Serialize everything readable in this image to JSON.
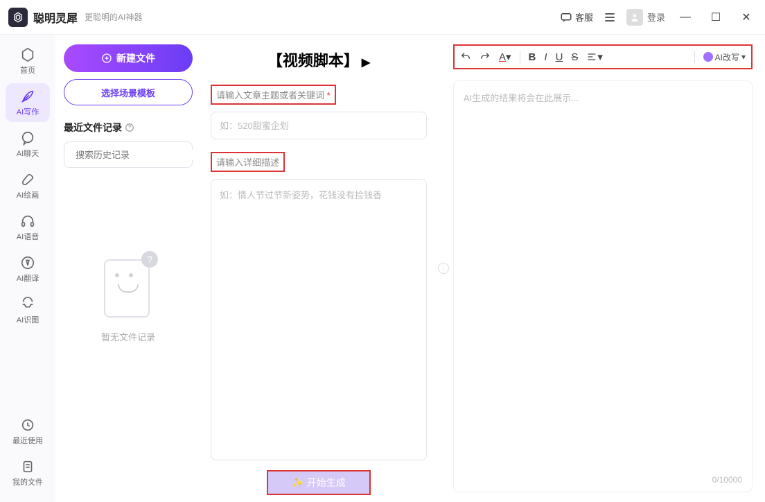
{
  "title": {
    "brand": "聪明灵犀",
    "sub": "更聪明的AI神器"
  },
  "header": {
    "kefu": "客服",
    "login": "登录"
  },
  "sidebar": {
    "items": [
      {
        "label": "首页"
      },
      {
        "label": "AI写作"
      },
      {
        "label": "AI聊天"
      },
      {
        "label": "AI绘画"
      },
      {
        "label": "AI语音"
      },
      {
        "label": "AI翻译"
      },
      {
        "label": "AI识图"
      },
      {
        "label": "最近使用"
      },
      {
        "label": "我的文件"
      }
    ]
  },
  "col2": {
    "new_file": "新建文件",
    "select_tpl": "选择场景模板",
    "recent_head": "最近文件记录",
    "search_ph": "搜索历史记录",
    "empty": "暂无文件记录"
  },
  "col3": {
    "heading": "【视频脚本】",
    "label1": "请输入文章主题或者关键词",
    "ph1": "如：520甜蜜企划",
    "label2": "请输入详细描述",
    "ph2": "如：情人节过节新姿势，花钱没有捡钱香",
    "generate": "开始生成"
  },
  "col4": {
    "ai_rewrite": "AI改写",
    "output_ph": "AI生成的结果将会在此展示...",
    "counter": "0/10000"
  }
}
